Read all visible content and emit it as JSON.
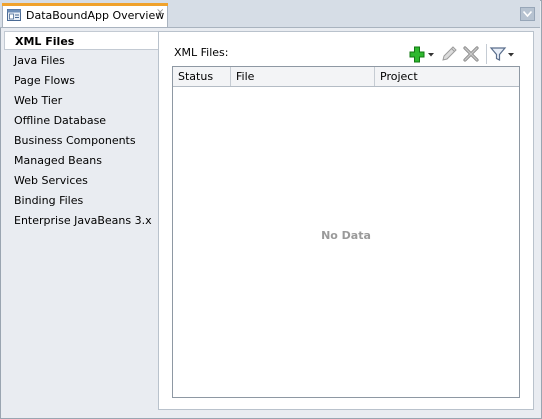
{
  "editor": {
    "tab_title": "DataBoundApp Overview",
    "tab_close_glyph": "×"
  },
  "nav": {
    "items": [
      {
        "label": "XML Files",
        "selected": true
      },
      {
        "label": "Java Files"
      },
      {
        "label": "Page Flows"
      },
      {
        "label": "Web Tier"
      },
      {
        "label": "Offline Database"
      },
      {
        "label": "Business Components"
      },
      {
        "label": "Managed Beans"
      },
      {
        "label": "Web Services"
      },
      {
        "label": "Binding Files"
      },
      {
        "label": "Enterprise JavaBeans 3.x"
      }
    ]
  },
  "table": {
    "title": "XML Files:",
    "columns": [
      "Status",
      "File",
      "Project"
    ],
    "empty_message": "No Data"
  },
  "toolbar": {
    "icons": [
      "add-icon",
      "dropdown-arrow-icon",
      "edit-icon",
      "delete-icon",
      "filter-icon",
      "dropdown-arrow-icon"
    ]
  },
  "colors": {
    "accent_tab": "#f0a22c",
    "add_green": "#1fa81f",
    "nodata_gray": "#9a9a9a"
  }
}
